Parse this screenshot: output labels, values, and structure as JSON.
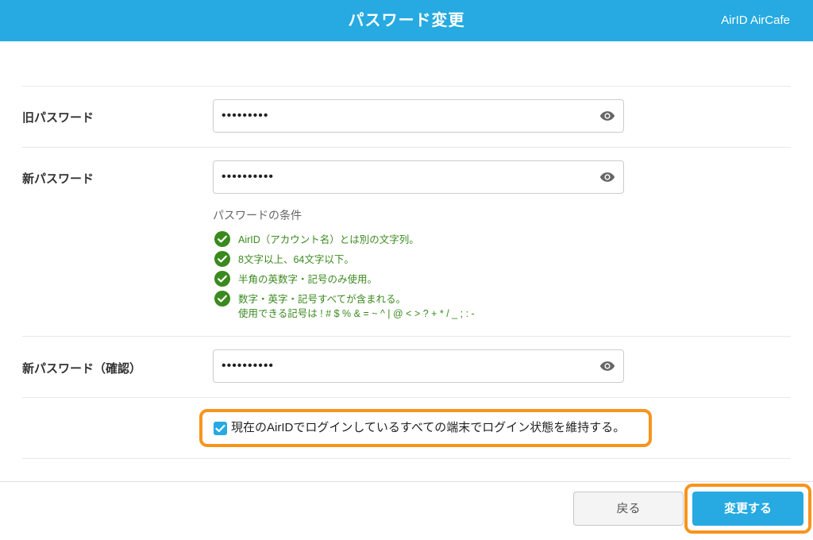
{
  "header": {
    "title": "パスワード変更",
    "brand": "AirID AirCafe"
  },
  "form": {
    "old_password": {
      "label": "旧パスワード",
      "value": "•••••••••"
    },
    "new_password": {
      "label": "新パスワード",
      "value": "••••••••••"
    },
    "confirm_password": {
      "label": "新パスワード（確認）",
      "value": "••••••••••"
    },
    "conditions": {
      "title": "パスワードの条件",
      "items": [
        {
          "text": "AirID（アカウント名）とは別の文字列。",
          "met": true
        },
        {
          "text": "8文字以上、64文字以下。",
          "met": true
        },
        {
          "text": "半角の英数字・記号のみ使用。",
          "met": true
        },
        {
          "text": "数字・英字・記号すべてが含まれる。",
          "met": true
        }
      ],
      "allowed_symbols": "使用できる記号は ! # $ % & = ~ ^ | @ < > ? + * / _ ; : -"
    },
    "keep_login": {
      "label": "現在のAirIDでログインしているすべての端末でログイン状態を維持する。",
      "checked": true
    }
  },
  "footer": {
    "back_label": "戻る",
    "submit_label": "変更する"
  },
  "colors": {
    "accent": "#26aae1",
    "highlight": "#f7941d",
    "success": "#3a8a1e"
  },
  "icons": {
    "visibility": "eye-icon",
    "condition": "check-circle-icon",
    "checkbox": "checkmark-icon"
  }
}
